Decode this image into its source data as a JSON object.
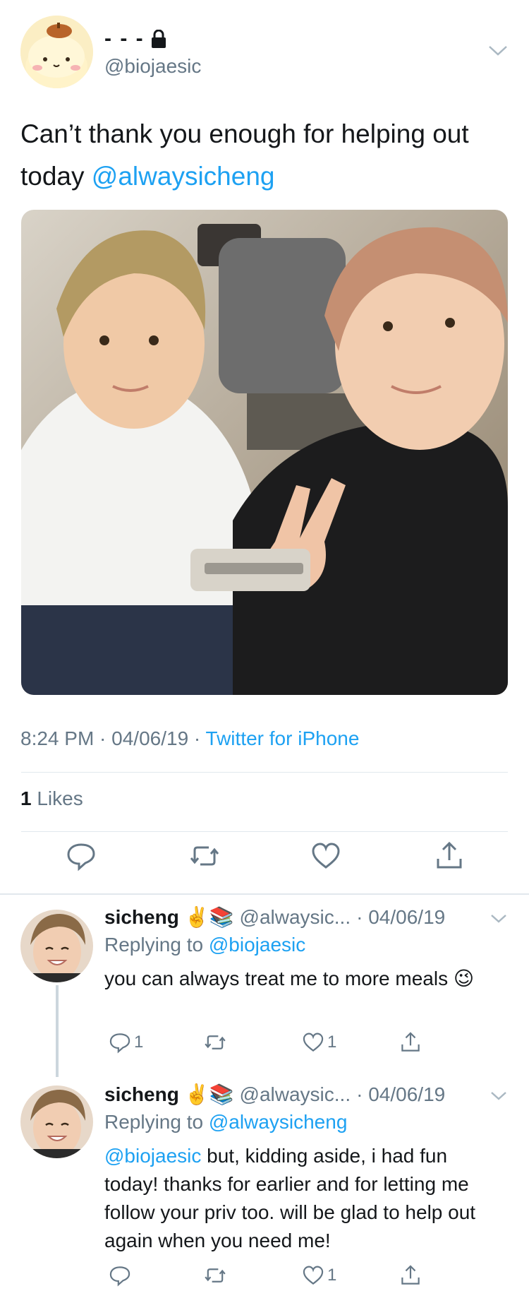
{
  "tweet": {
    "display_name": "- - -",
    "handle": "@biojaesic",
    "text_prefix": "Can’t thank you enough for helping out today ",
    "mention": "@alwaysicheng",
    "timestamp": "8:24 PM · 04/06/19 · ",
    "source": "Twitter for iPhone",
    "likes_count": "1",
    "likes_label": " Likes"
  },
  "replies": [
    {
      "name": "sicheng",
      "emojis": "✌️📚",
      "handle": "@alwaysic...",
      "date": "· 04/06/19",
      "replying_label": "Replying to ",
      "replying_to": "@biojaesic",
      "mention": "",
      "text": "you can always treat me to more meals 😉",
      "reply_count": "1",
      "retweet_count": "",
      "like_count": "1"
    },
    {
      "name": "sicheng",
      "emojis": "✌️📚",
      "handle": "@alwaysic...",
      "date": "· 04/06/19",
      "replying_label": "Replying to ",
      "replying_to": "@alwaysicheng",
      "mention": "@biojaesic",
      "text": " but, kidding aside, i had fun today! thanks for earlier and for letting me follow your priv too. will be glad to help out again when you need me!",
      "reply_count": "",
      "retweet_count": "",
      "like_count": "1"
    }
  ],
  "colors": {
    "link": "#1da1f2",
    "secondary_text": "#657786",
    "divider": "#e1e8ed"
  },
  "icons": [
    "lock-icon",
    "chevron-down-icon",
    "reply-icon",
    "retweet-icon",
    "like-icon",
    "share-icon"
  ]
}
